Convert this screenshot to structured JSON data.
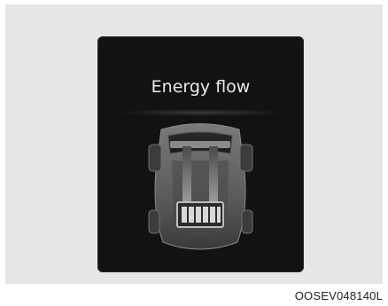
{
  "screen": {
    "title": "Energy flow"
  },
  "caption": "OOSEV048140L",
  "icons": {
    "vehicle": "car-top-view-icon",
    "battery": "battery-icon",
    "flow": "energy-flow-lines"
  },
  "colors": {
    "screen_bg": "#121212",
    "car_body": "#6a6a6a",
    "battery": "#d8d8d8"
  }
}
